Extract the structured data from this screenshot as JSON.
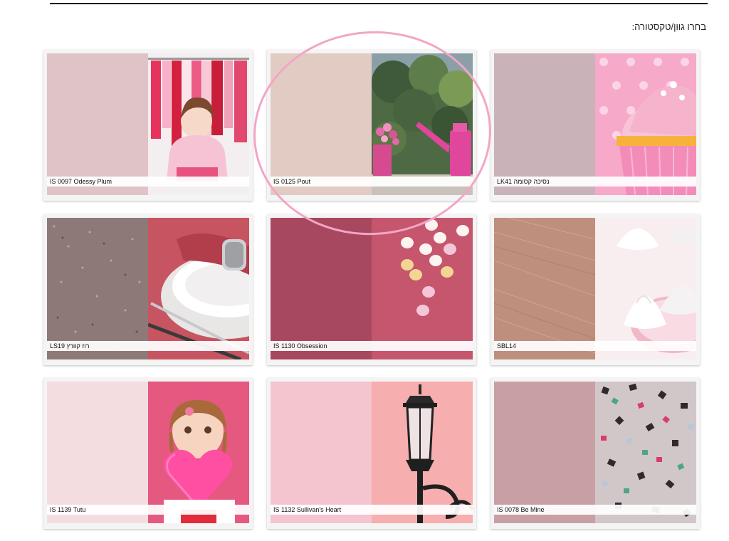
{
  "heading": "בחרו גוון/טקסטורה:",
  "colors": {
    "rule": "#1a1a1a",
    "highlight": "#f2a6c6"
  },
  "cards": [
    {
      "label": "IS 0097  Odessy Plum",
      "swatch": "#dfc3c7",
      "photo": "child-clothes-rack"
    },
    {
      "label": "IS 0125  Pout",
      "swatch": "#e2cbc2",
      "photo": "garden-watering-can"
    },
    {
      "label": "LK41  נסיכה קסומה",
      "swatch": "#c9b3b8",
      "photo": "pink-cupcake"
    },
    {
      "label": "LS19  רוז קוורץ",
      "swatch": "#8d7a78",
      "photo": "napkin-and-plate"
    },
    {
      "label": "IS 1130  Obsession",
      "swatch": "#a8485f",
      "photo": "candy-hearts"
    },
    {
      "label": "SBL14",
      "swatch": "#bf8f7d",
      "photo": "meringues"
    },
    {
      "label": "IS 1139  Tutu",
      "swatch": "#f4dde0",
      "photo": "girl-with-heart"
    },
    {
      "label": "IS 1132  Sullivan's Heart",
      "swatch": "#f4c4cf",
      "photo": "street-lamp"
    },
    {
      "label": "IS 0078  Be Mine",
      "swatch": "#c8a0a4",
      "photo": "confetti"
    }
  ]
}
